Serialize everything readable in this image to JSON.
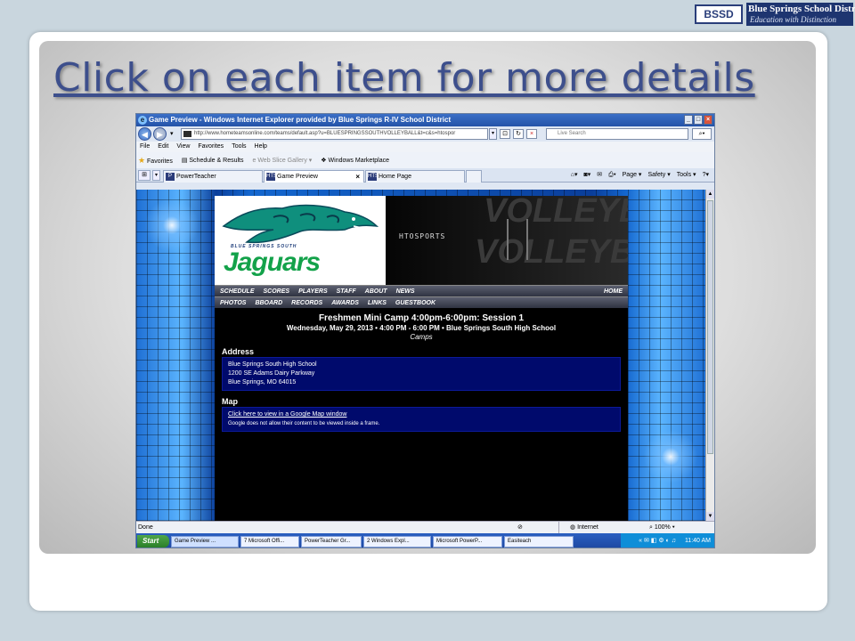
{
  "logo": {
    "abbr": "BSSD",
    "name": "Blue Springs School District",
    "tagline": "Education with Distinction"
  },
  "slide": {
    "title": "Click on each item for more details"
  },
  "browser": {
    "window_title": "Game Preview - Windows Internet Explorer provided by Blue Springs R-IV School District",
    "url": "http://www.hometeamsonline.com/teams/default.asp?u=BLUESPRINGSSOUTHVOLLEYBALL&t=c&s=htospor",
    "search_placeholder": "Live Search",
    "menu": [
      "File",
      "Edit",
      "View",
      "Favorites",
      "Tools",
      "Help"
    ],
    "favorites_bar": {
      "favorites_label": "Favorites",
      "items": [
        "Schedule & Results",
        "Web Slice Gallery ▾",
        "Windows Marketplace"
      ]
    },
    "tabs": [
      {
        "label": "PowerTeacher",
        "icon": "P"
      },
      {
        "label": "Game Preview",
        "icon": "HTS"
      },
      {
        "label": "Home Page",
        "icon": "HTS"
      }
    ],
    "command_bar": [
      "Page ▾",
      "Safety ▾",
      "Tools ▾"
    ],
    "status": {
      "left": "Done",
      "zone": "Internet",
      "zoom": "100%"
    }
  },
  "site": {
    "school_small": "BLUE SPRINGS SOUTH",
    "mascot": "Jaguars",
    "brand": "HTOSPORTS",
    "banner_word": "VOLLEYBALL",
    "nav_row1": [
      "SCHEDULE",
      "SCORES",
      "PLAYERS",
      "STAFF",
      "ABOUT",
      "NEWS"
    ],
    "nav_home": "HOME",
    "nav_row2": [
      "PHOTOS",
      "BBOARD",
      "RECORDS",
      "AWARDS",
      "LINKS",
      "GUESTBOOK"
    ],
    "event": {
      "title": "Freshmen Mini Camp 4:00pm-6:00pm: Session 1",
      "datetime": "Wednesday, May 29, 2013 • 4:00 PM - 6:00 PM • Blue Springs South High School",
      "category": "Camps"
    },
    "address": {
      "heading": "Address",
      "line1": "Blue Springs South High School",
      "line2": "1200 SE Adams Dairy Parkway",
      "line3": "Blue Springs, MO 64015"
    },
    "map": {
      "heading": "Map",
      "link": "Click here to view in a Google Map window",
      "note": "Google does not allow their content to be viewed inside a frame."
    }
  },
  "taskbar": {
    "start": "Start",
    "buttons": [
      "Game Preview ...",
      "7 Microsoft Offi...",
      "PowerTeacher Gr...",
      "2 Windows Expl...",
      "Microsoft PowerP...",
      "Easiteach"
    ],
    "clock": "11:40 AM"
  }
}
